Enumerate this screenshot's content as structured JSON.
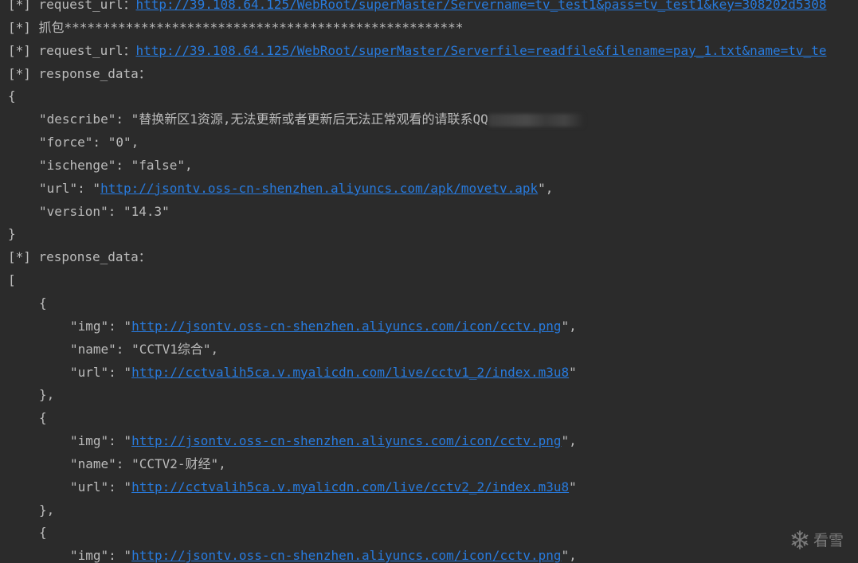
{
  "console": {
    "line1": {
      "prefix": "[*] request_url：",
      "link": "http://39.108.64.125/WebRoot/superMaster/Servername=tv_test1&pass=tv_test1&key=308202d5308"
    },
    "line2": {
      "text": "[*] 抓包****************************************************"
    },
    "line3": {
      "prefix": "[*] request_url：",
      "link": "http://39.108.64.125/WebRoot/superMaster/Serverfile=readfile&filename=pay_1.txt&name=tv_te"
    },
    "line4": {
      "text": "[*] response_data："
    },
    "line5": {
      "text": "{"
    },
    "line6": {
      "text": "\"describe\": \"替换新区1资源,无法更新或者更新后无法正常观看的请联系QQ"
    },
    "line7": {
      "text": "\"force\": \"0\","
    },
    "line8": {
      "text": "\"ischenge\": \"false\","
    },
    "line9": {
      "prefix": "\"url\": \"",
      "link": "http://jsontv.oss-cn-shenzhen.aliyuncs.com/apk/movetv.apk",
      "suffix": "\","
    },
    "line10": {
      "text": "\"version\": \"14.3\""
    },
    "line11": {
      "text": "}"
    },
    "line12": {
      "text": "[*] response_data："
    },
    "line13": {
      "text": "["
    },
    "line14": {
      "text": "{"
    },
    "line15": {
      "prefix": "\"img\": \"",
      "link": "http://jsontv.oss-cn-shenzhen.aliyuncs.com/icon/cctv.png",
      "suffix": "\","
    },
    "line16": {
      "text": "\"name\": \"CCTV1综合\","
    },
    "line17": {
      "prefix": "\"url\": \"",
      "link": "http://cctvalih5ca.v.myalicdn.com/live/cctv1_2/index.m3u8",
      "suffix": "\""
    },
    "line18": {
      "text": "},"
    },
    "line19": {
      "text": "{"
    },
    "line20": {
      "prefix": "\"img\": \"",
      "link": "http://jsontv.oss-cn-shenzhen.aliyuncs.com/icon/cctv.png",
      "suffix": "\","
    },
    "line21": {
      "text": "\"name\": \"CCTV2-财经\","
    },
    "line22": {
      "prefix": "\"url\": \"",
      "link": "http://cctvalih5ca.v.myalicdn.com/live/cctv2_2/index.m3u8",
      "suffix": "\""
    },
    "line23": {
      "text": "},"
    },
    "line24": {
      "text": "{"
    },
    "line25": {
      "prefix": "\"img\": \"",
      "link": "http://jsontv.oss-cn-shenzhen.aliyuncs.com/icon/cctv.png",
      "suffix": "\","
    }
  },
  "watermark": {
    "text": "看雪",
    "icon": "snowflake-icon"
  },
  "colors": {
    "background": "#2b2b2b",
    "text": "#bbbbbb",
    "link": "#287bde"
  }
}
